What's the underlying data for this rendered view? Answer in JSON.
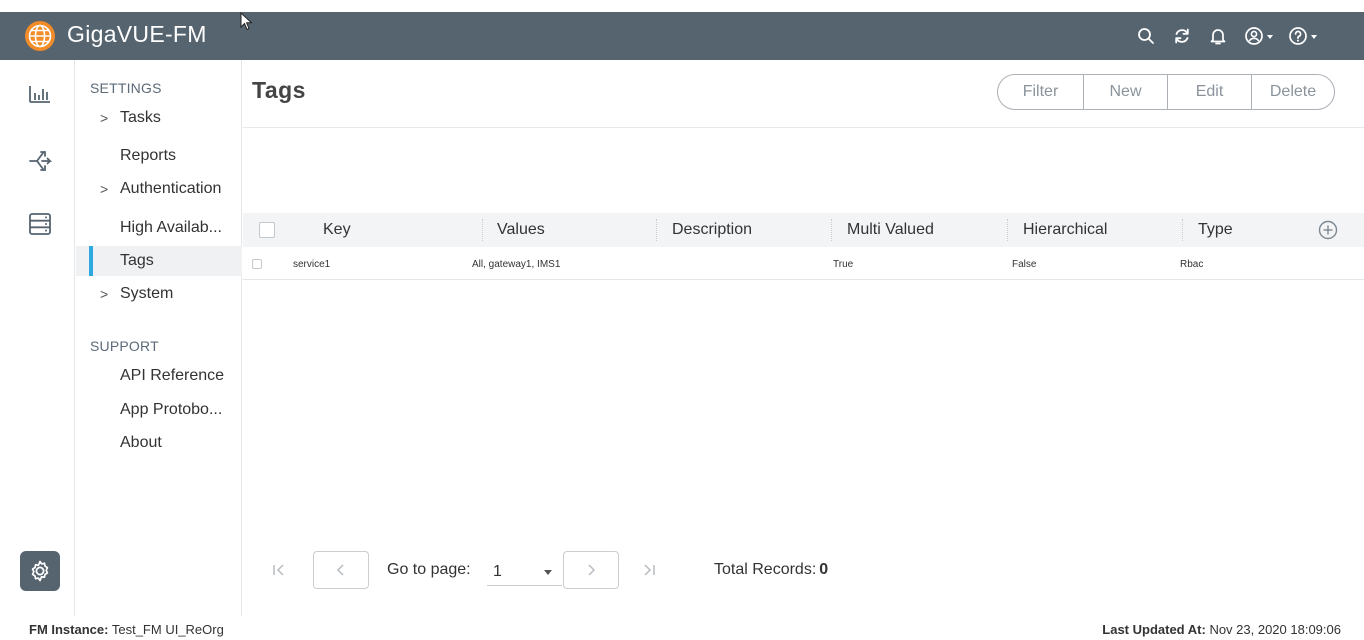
{
  "app": {
    "title": "GigaVUE-FM"
  },
  "header_icons": [
    "search-icon",
    "refresh-icon",
    "bell-icon",
    "user-icon",
    "help-icon"
  ],
  "rail": {
    "icons": [
      "dashboard-icon",
      "traffic-icon",
      "inventory-icon"
    ],
    "active": "settings-gear-icon"
  },
  "sidebar": {
    "settings_heading": "SETTINGS",
    "items": [
      {
        "label": "Tasks",
        "expandable": true
      },
      {
        "label": "Reports",
        "expandable": false
      },
      {
        "label": "Authentication",
        "expandable": true
      },
      {
        "label": "High Availab...",
        "expandable": false
      },
      {
        "label": "Tags",
        "expandable": false,
        "active": true
      },
      {
        "label": "System",
        "expandable": true
      }
    ],
    "support_heading": "SUPPORT",
    "support_items": [
      {
        "label": "API Reference"
      },
      {
        "label": "App Protobo..."
      },
      {
        "label": "About"
      }
    ]
  },
  "page": {
    "title": "Tags",
    "actions": {
      "filter": "Filter",
      "new": "New",
      "edit": "Edit",
      "delete": "Delete"
    }
  },
  "table": {
    "columns": [
      "Key",
      "Values",
      "Description",
      "Multi Valued",
      "Hierarchical",
      "Type"
    ],
    "rows": [
      {
        "key": "service1",
        "values": "All, gateway1, IMS1",
        "description": "",
        "multi_valued": "True",
        "hierarchical": "False",
        "type": "Rbac"
      }
    ]
  },
  "pager": {
    "goto_label": "Go to page:",
    "page_value": "1",
    "total_label": "Total Records:",
    "total_value": "0"
  },
  "footer": {
    "instance_label": "FM Instance:",
    "instance_value": "Test_FM UI_ReOrg",
    "updated_label": "Last Updated At:",
    "updated_value": "Nov 23, 2020 18:09:06"
  },
  "colors": {
    "header_bg": "#566470",
    "active_accent": "#2ea8e0"
  }
}
